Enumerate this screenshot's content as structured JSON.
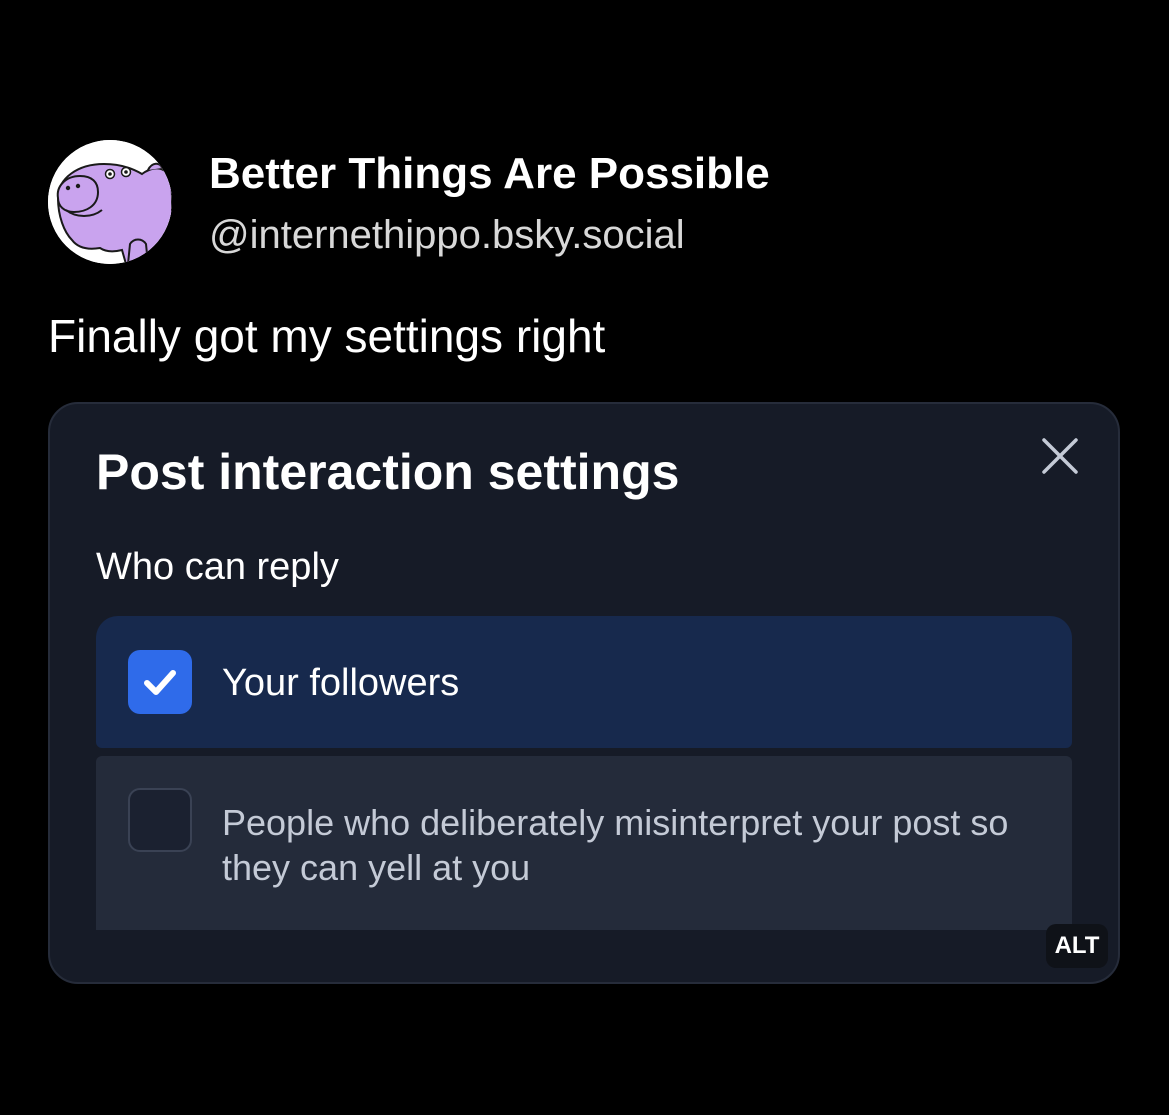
{
  "author": {
    "display_name": "Better Things Are Possible",
    "handle": "@internethippo.bsky.social",
    "avatar_icon": "hippo-avatar"
  },
  "post": {
    "text": "Finally got my settings right"
  },
  "settings_card": {
    "title": "Post interaction settings",
    "close_icon": "close-icon",
    "section_label": "Who can reply",
    "options": [
      {
        "label": "Your followers",
        "checked": true
      },
      {
        "label": "People who deliberately misinterpret your post so they can yell at you",
        "checked": false
      }
    ],
    "alt_badge": "ALT"
  },
  "colors": {
    "background": "#000000",
    "card": "#161b27",
    "selected_option": "#17294d",
    "unselected_option": "#242b3a",
    "checkbox_accent": "#2f6bea",
    "avatar_hippo": "#c9a3ee"
  }
}
